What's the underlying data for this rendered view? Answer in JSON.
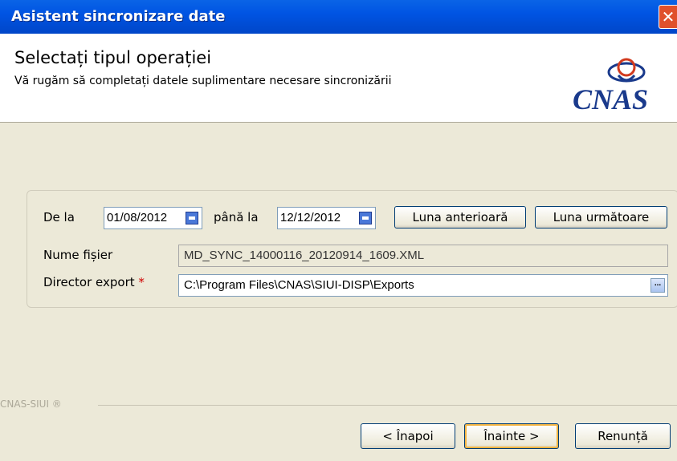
{
  "window": {
    "title": "Asistent sincronizare date",
    "close_glyph": "✕"
  },
  "header": {
    "title": "Selectați tipul operației",
    "subtitle": "Vă rugăm să completați datele suplimentare necesare sincronizării",
    "logo_text": "CNAS"
  },
  "form": {
    "from_label": "De la",
    "from_value": "01/08/2012",
    "to_label": "până la",
    "to_value": "12/12/2012",
    "prev_month_label": "Luna anterioară",
    "next_month_label": "Luna următoare",
    "filename_label": "Nume fișier",
    "filename_value": "MD_SYNC_14000116_20120914_1609.XML",
    "export_dir_label": "Director export",
    "required_mark": "*",
    "export_dir_value": "C:\\Program Files\\CNAS\\SIUI-DISP\\Exports",
    "browse_label": "..."
  },
  "footer": {
    "brand": "CNAS-SIUI ®",
    "back_label": "< Înapoi",
    "next_label": "Înainte >",
    "cancel_label": "Renunță"
  },
  "colors": {
    "titlebar": "#0054e3",
    "panel": "#ece9d8",
    "required": "#d00000",
    "default_button_border": "#f3b443"
  },
  "icons": [
    "close-icon",
    "calendar-icon",
    "cnas-logo"
  ]
}
